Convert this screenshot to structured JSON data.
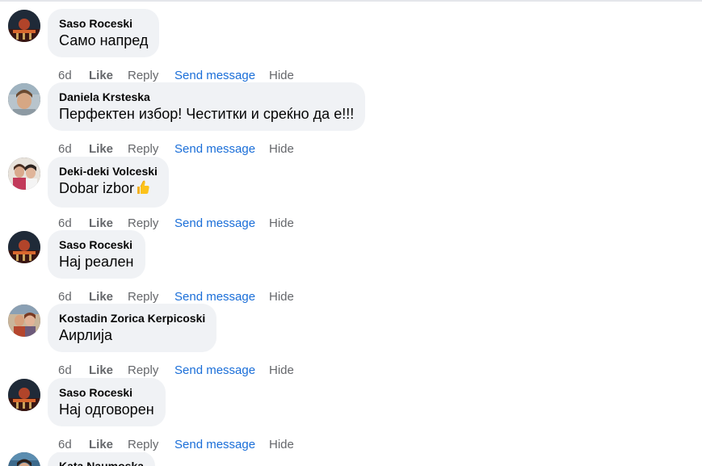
{
  "comments": [
    {
      "author": "Saso Roceski",
      "text": "Само напред",
      "avatar": "saso-avatar",
      "time": "6d"
    },
    {
      "author": "Daniela Krsteska",
      "text": "Перфектен избор! Честитки и среќно да е!!!",
      "avatar": "daniela-avatar",
      "time": "6d"
    },
    {
      "author": "Deki-deki Volceski",
      "text": "Dobar izbor",
      "emoji": "thumbs-up-icon",
      "avatar": "deki-avatar",
      "time": "6d"
    },
    {
      "author": "Saso Roceski",
      "text": "Нај реален",
      "avatar": "saso-avatar",
      "time": "6d"
    },
    {
      "author": "Kostadin Zorica Kerpicoski",
      "text": "Аирлија",
      "avatar": "kostadin-avatar",
      "time": "6d"
    },
    {
      "author": "Saso Roceski",
      "text": "Нај одговорен",
      "avatar": "saso-avatar",
      "time": "6d"
    },
    {
      "author": "Kata Naumoska",
      "text": "",
      "avatar": "kata-avatar",
      "time": ""
    }
  ],
  "actions": {
    "like": "Like",
    "reply": "Reply",
    "send_message": "Send message",
    "hide": "Hide"
  },
  "colors": {
    "bubble": "#f0f2f5",
    "link": "#1a6ed8",
    "meta": "#65676b",
    "text": "#050505"
  }
}
